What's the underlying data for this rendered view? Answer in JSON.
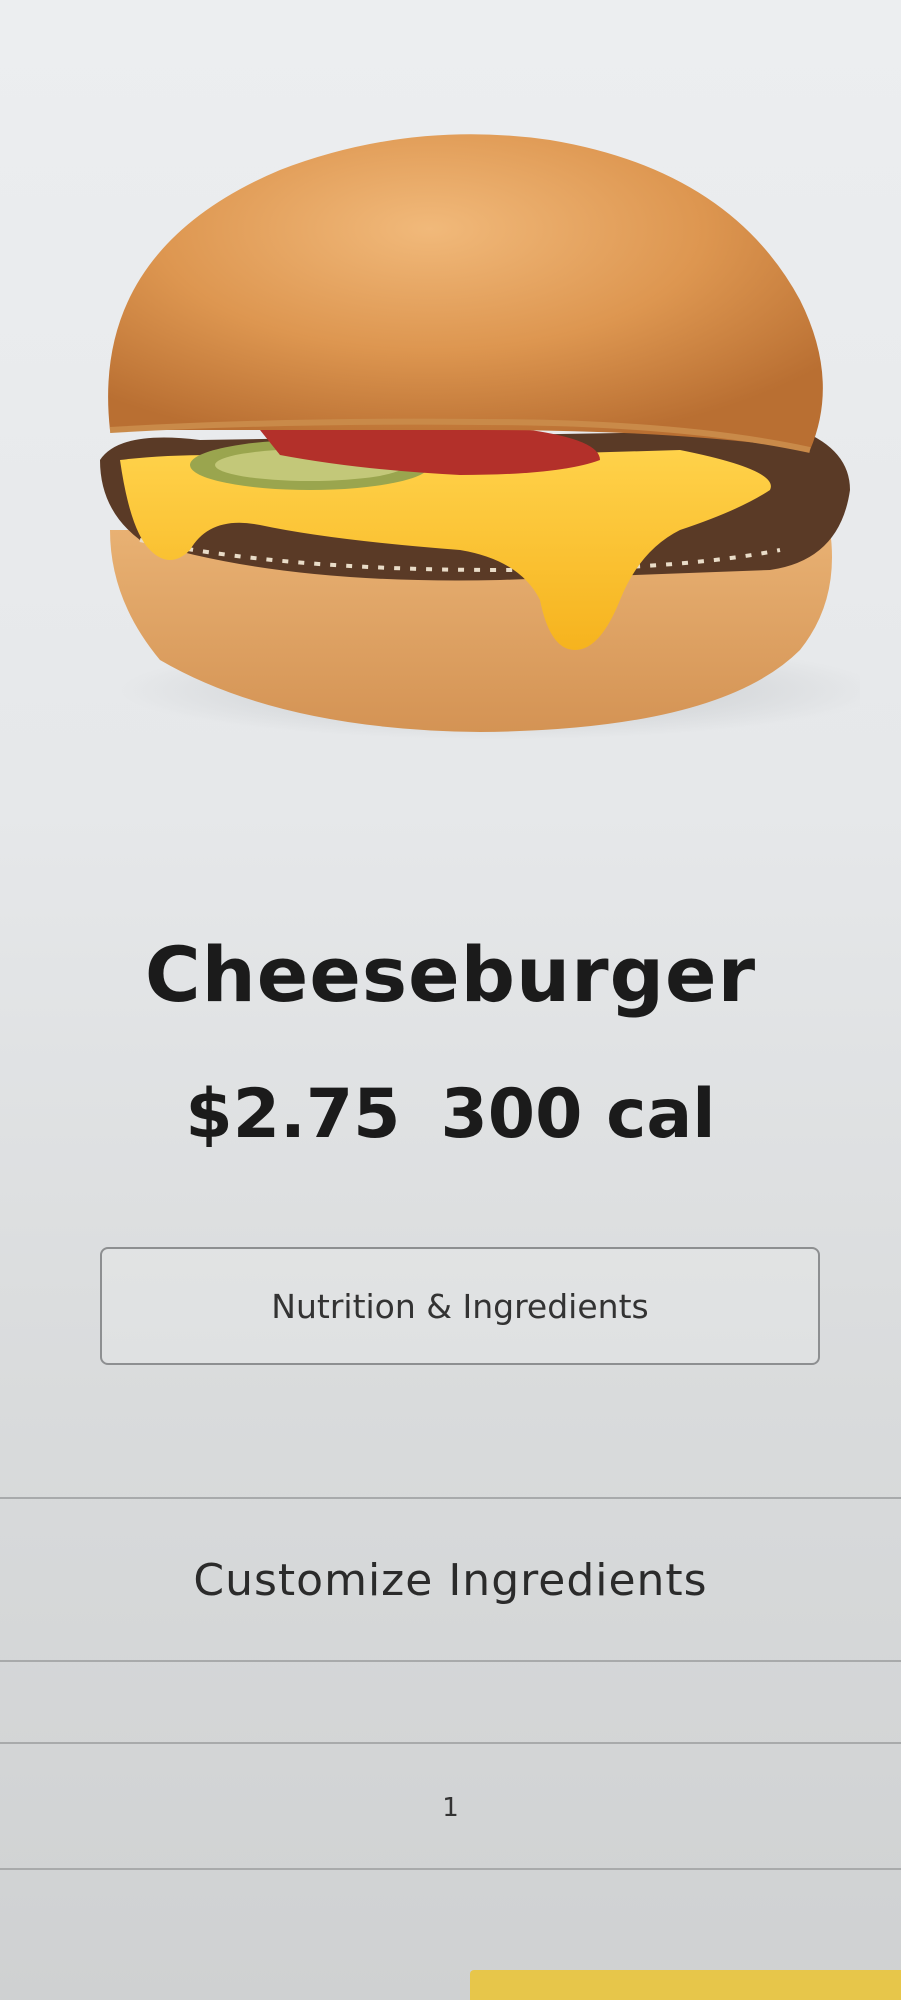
{
  "product": {
    "name": "Cheeseburger",
    "price": "$2.75",
    "calories": "300 cal",
    "image_icon": "cheeseburger-image"
  },
  "actions": {
    "nutrition_label": "Nutrition & Ingredients",
    "customize_label": "Customize Ingredients"
  },
  "quantity": {
    "value": "1"
  },
  "colors": {
    "accent": "#e7c64a",
    "text": "#1b1b1b"
  }
}
